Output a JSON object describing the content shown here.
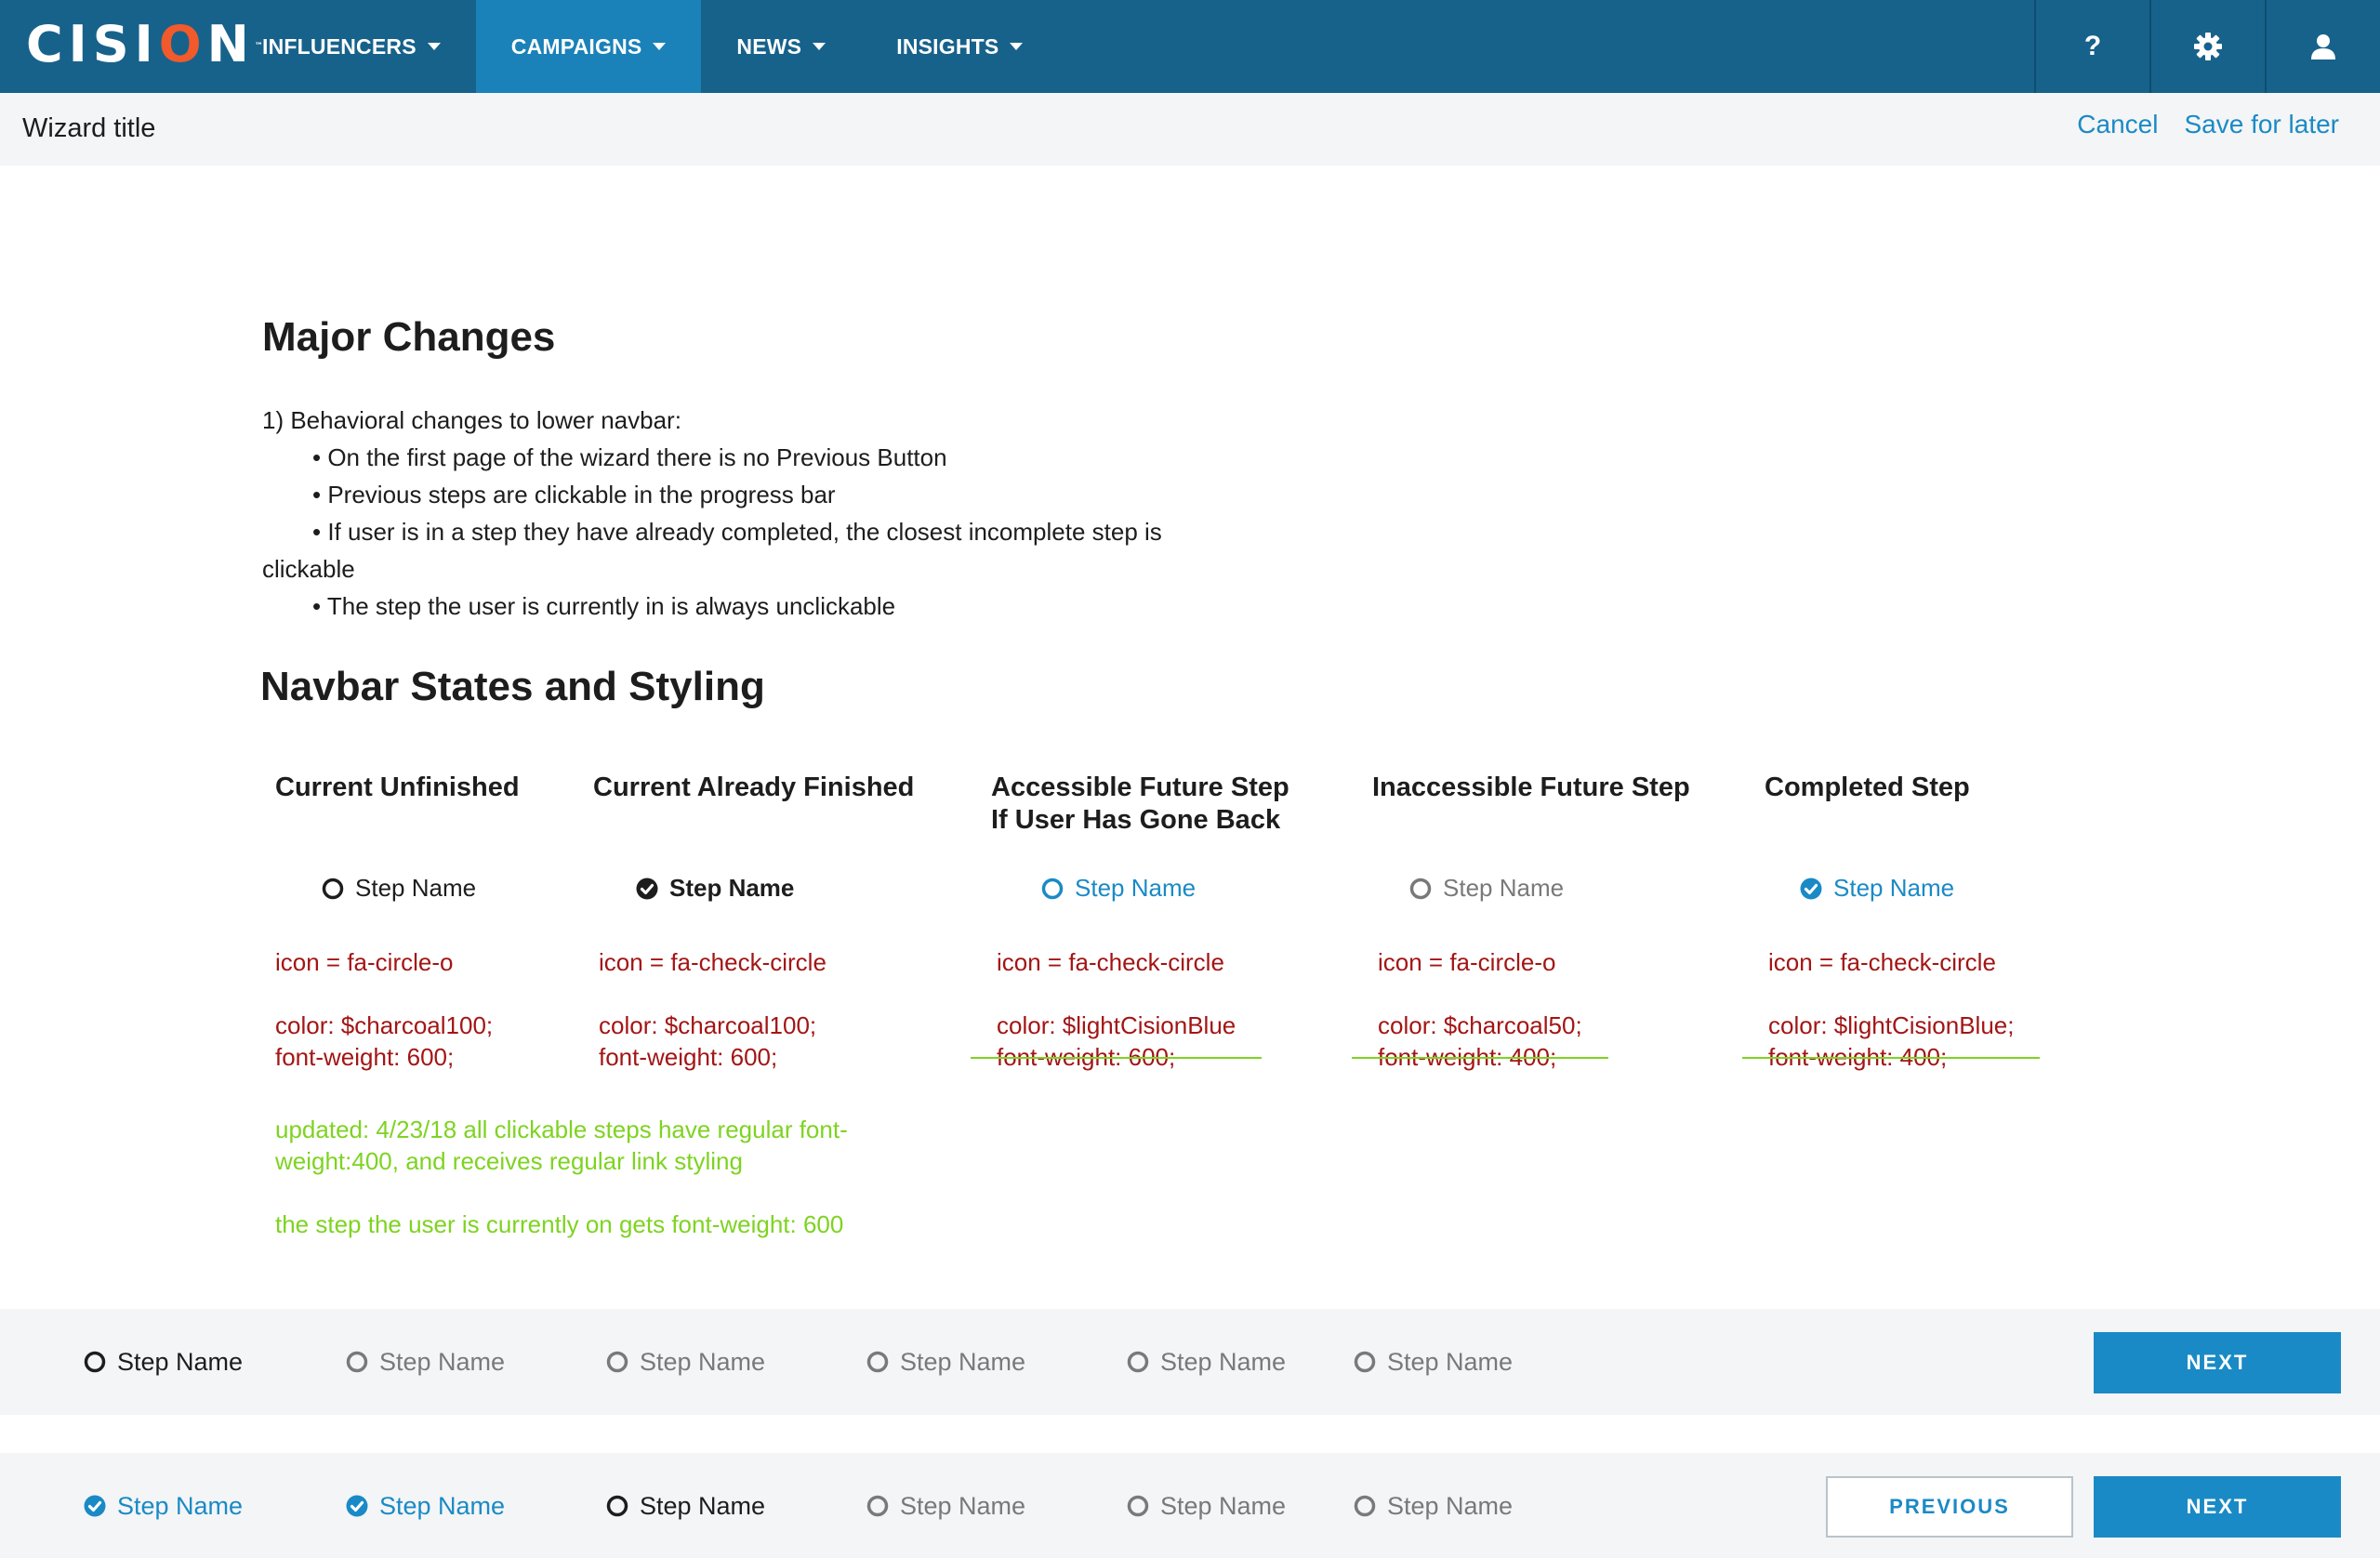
{
  "topnav": {
    "logo_parts": [
      "CISI",
      "O",
      "N"
    ],
    "logo_tm": "™",
    "menu": [
      "INFLUENCERS",
      "CAMPAIGNS",
      "NEWS",
      "INSIGHTS"
    ],
    "active_menu": "CAMPAIGNS",
    "icons": [
      "help-icon",
      "gear-icon",
      "user-icon"
    ],
    "help_label": "?"
  },
  "wizard": {
    "title": "Wizard title",
    "cancel": "Cancel",
    "save_for_later": "Save for later"
  },
  "doc": {
    "major_heading": "Major Changes",
    "intro": "1) Behavioral changes to lower navbar:",
    "bullets": [
      "On the first page of the wizard there is no Previous Button",
      "Previous steps are clickable in the progress bar",
      "If user is in a step they have already completed, the closest incomplete step is"
    ],
    "wrap": "clickable",
    "last_bullet": "The step the user is currently in is always unclickable",
    "navbar_heading": "Navbar States and Styling",
    "columns": [
      {
        "title_lines": [
          "Current Unfinished"
        ],
        "step": "Step Name",
        "icon": "fa-circle-o",
        "spec_icon": "icon = fa-circle-o",
        "spec_color": "color: $charcoal100;",
        "spec_weight": "font-weight: 600;"
      },
      {
        "title_lines": [
          "Current Already Finished"
        ],
        "step": "Step Name",
        "icon": "fa-check-circle",
        "spec_icon": "icon = fa-check-circle",
        "spec_color": "color: $charcoal100;",
        "spec_weight": "font-weight: 600;"
      },
      {
        "title_lines": [
          "Accessible Future Step",
          "If User Has Gone Back"
        ],
        "step": "Step Name",
        "icon": "fa-circle-o",
        "spec_icon": "icon = fa-check-circle",
        "spec_color": "color: $lightCisionBlue",
        "spec_weight": "font-weight: 600;"
      },
      {
        "title_lines": [
          "Inaccessible Future Step"
        ],
        "step": "Step Name",
        "icon": "fa-circle-o",
        "spec_icon": "icon = fa-circle-o",
        "spec_color": "color: $charcoal50;",
        "spec_weight": "font-weight: 400;"
      },
      {
        "title_lines": [
          "Completed Step"
        ],
        "step": "Step Name",
        "icon": "fa-check-circle",
        "spec_icon": "icon = fa-check-circle",
        "spec_color": "color: $lightCisionBlue;",
        "spec_weight": "font-weight: 400;"
      }
    ],
    "updates": [
      "updated: 4/23/18 all clickable steps have regular font-weight:400, and receives regular link styling",
      "the step the user is currently on gets font-weight: 600"
    ]
  },
  "stepbar_one": {
    "steps": [
      "Step Name",
      "Step Name",
      "Step Name",
      "Step Name",
      "Step Name",
      "Step Name"
    ],
    "next": "NEXT"
  },
  "stepbar_two": {
    "steps": [
      "Step Name",
      "Step Name",
      "Step Name",
      "Step Name",
      "Step Name",
      "Step Name"
    ],
    "previous": "PREVIOUS",
    "next": "NEXT"
  },
  "colors": {
    "brand_nav": "#17628b",
    "active_nav": "#1a82b8",
    "link_blue": "#1a8ac6",
    "logo_accent": "#f15a2b",
    "spec_red": "#a31515",
    "update_green": "#7ed321",
    "charcoal100": "#1d1d1d",
    "charcoal50": "#797979"
  }
}
